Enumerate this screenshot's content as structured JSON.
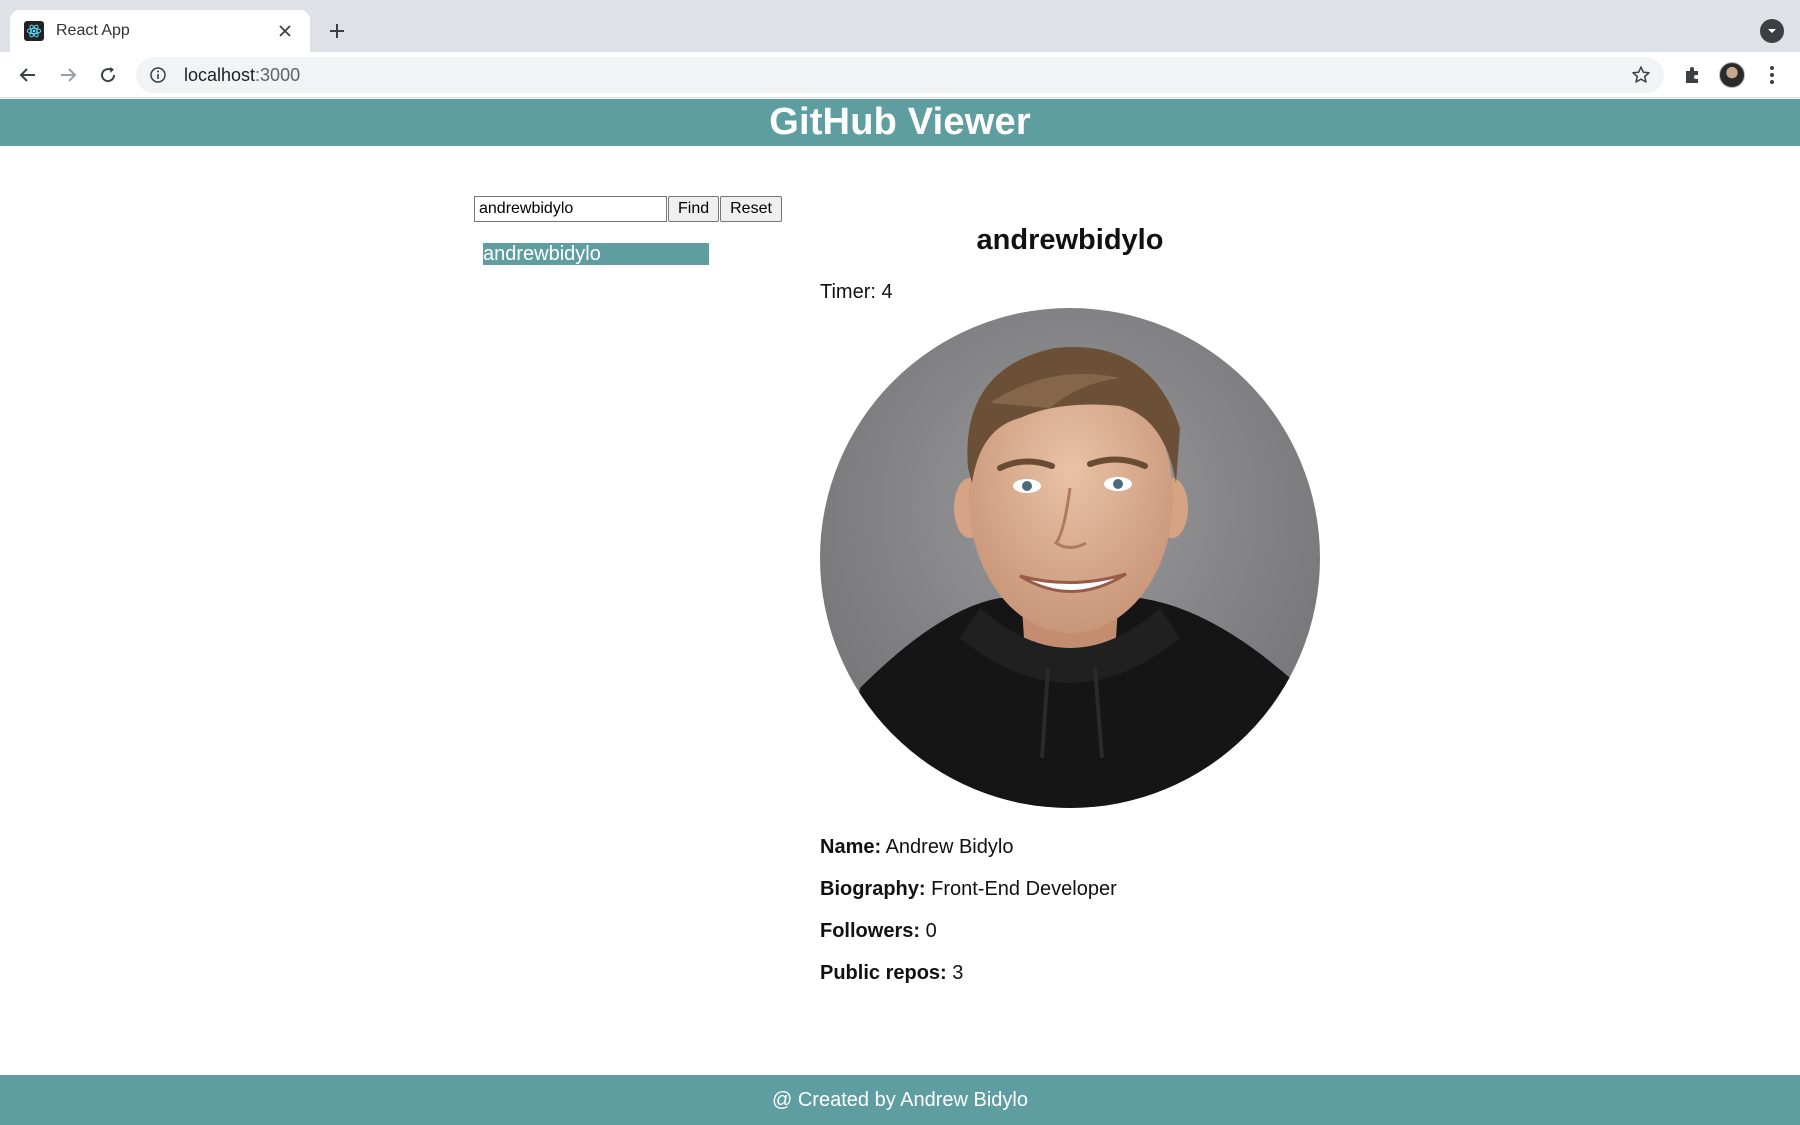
{
  "browser": {
    "tab_title": "React App",
    "url_host": "localhost",
    "url_port": ":3000"
  },
  "header": {
    "title": "GitHub Viewer"
  },
  "search": {
    "value": "andrewbidylo",
    "find_label": "Find",
    "reset_label": "Reset"
  },
  "results": {
    "items": [
      "andrewbidylo"
    ]
  },
  "details": {
    "login": "andrewbidylo",
    "timer_label": "Timer:",
    "timer_value": "4",
    "name_label": "Name:",
    "name_value": "Andrew Bidylo",
    "bio_label": "Biography:",
    "bio_value": "Front-End Developer",
    "followers_label": "Followers:",
    "followers_value": "0",
    "repos_label": "Public repos:",
    "repos_value": "3"
  },
  "footer": {
    "text": "@ Created by Andrew Bidylo"
  },
  "colors": {
    "accent": "#5f9ea0"
  }
}
